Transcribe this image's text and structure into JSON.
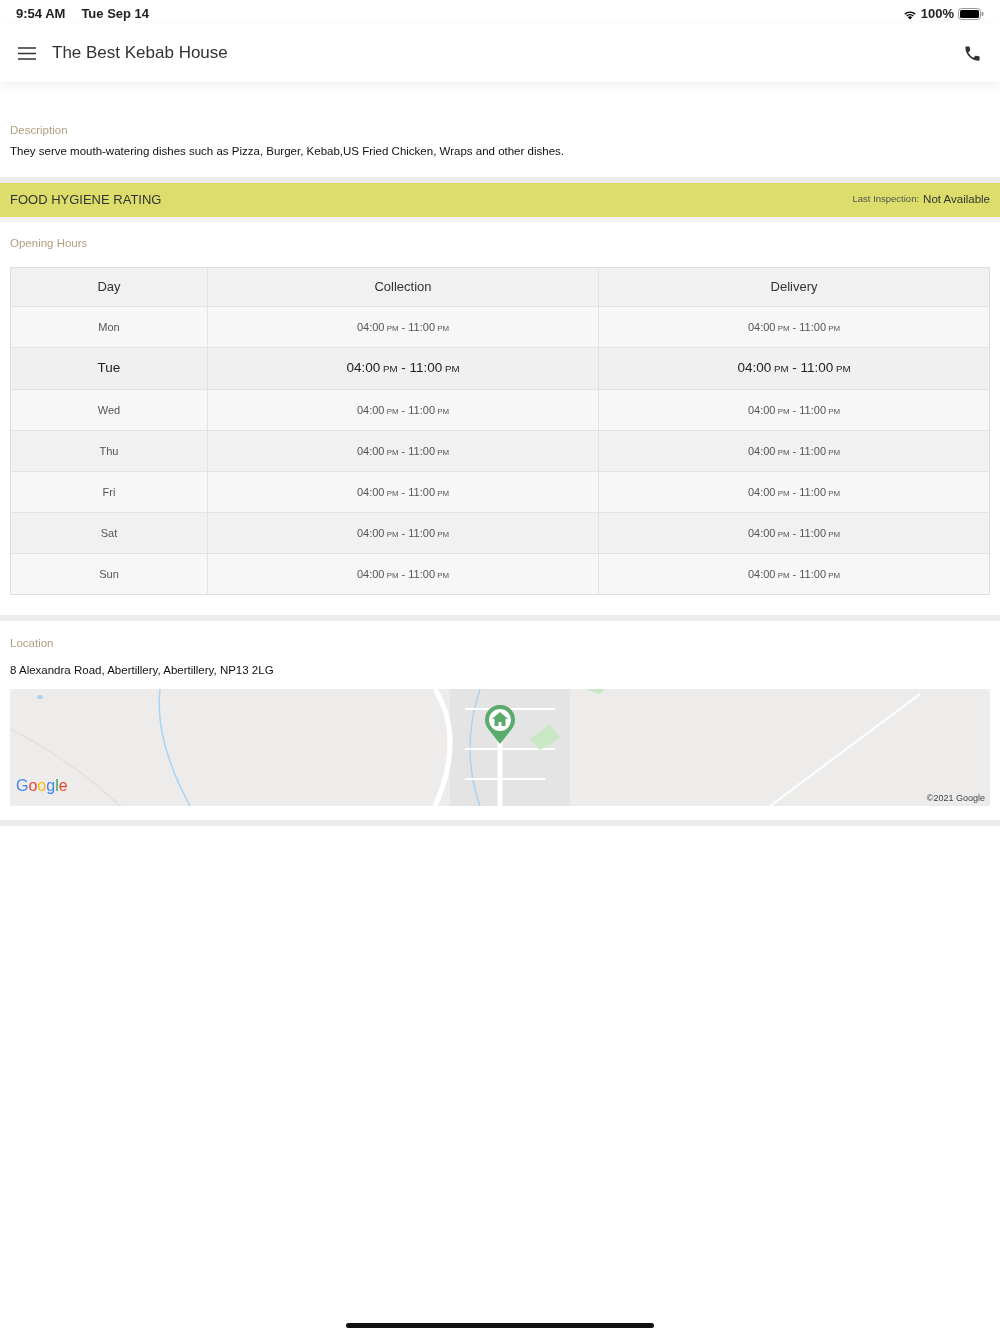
{
  "status_bar": {
    "time": "9:54 AM",
    "date": "Tue Sep 14",
    "battery": "100%"
  },
  "header": {
    "title": "The Best Kebab House"
  },
  "description": {
    "label": "Description",
    "text": "They serve mouth-watering dishes such as Pizza, Burger, Kebab,US Fried Chicken, Wraps  and other dishes."
  },
  "hygiene": {
    "title": "FOOD HYGIENE RATING",
    "inspection_label": "Last Inspection:",
    "inspection_value": "Not Available"
  },
  "opening_hours": {
    "label": "Opening Hours",
    "columns": [
      "Day",
      "Collection",
      "Delivery"
    ],
    "rows": [
      {
        "day": "Mon",
        "selected": false,
        "collection": {
          "from": "04:00",
          "from_suffix": "PM",
          "separator": "-",
          "to": "11:00",
          "to_suffix": "PM"
        },
        "delivery": {
          "from": "04:00",
          "from_suffix": "PM",
          "separator": "-",
          "to": "11:00",
          "to_suffix": "PM"
        }
      },
      {
        "day": "Tue",
        "selected": true,
        "collection": {
          "from": "04:00",
          "from_suffix": "PM",
          "separator": "-",
          "to": "11:00",
          "to_suffix": "PM"
        },
        "delivery": {
          "from": "04:00",
          "from_suffix": "PM",
          "separator": "-",
          "to": "11:00",
          "to_suffix": "PM"
        }
      },
      {
        "day": "Wed",
        "selected": false,
        "collection": {
          "from": "04:00",
          "from_suffix": "PM",
          "separator": "-",
          "to": "11:00",
          "to_suffix": "PM"
        },
        "delivery": {
          "from": "04:00",
          "from_suffix": "PM",
          "separator": "-",
          "to": "11:00",
          "to_suffix": "PM"
        }
      },
      {
        "day": "Thu",
        "selected": false,
        "collection": {
          "from": "04:00",
          "from_suffix": "PM",
          "separator": "-",
          "to": "11:00",
          "to_suffix": "PM"
        },
        "delivery": {
          "from": "04:00",
          "from_suffix": "PM",
          "separator": "-",
          "to": "11:00",
          "to_suffix": "PM"
        }
      },
      {
        "day": "Fri",
        "selected": false,
        "collection": {
          "from": "04:00",
          "from_suffix": "PM",
          "separator": "-",
          "to": "11:00",
          "to_suffix": "PM"
        },
        "delivery": {
          "from": "04:00",
          "from_suffix": "PM",
          "separator": "-",
          "to": "11:00",
          "to_suffix": "PM"
        }
      },
      {
        "day": "Sat",
        "selected": false,
        "collection": {
          "from": "04:00",
          "from_suffix": "PM",
          "separator": "-",
          "to": "11:00",
          "to_suffix": "PM"
        },
        "delivery": {
          "from": "04:00",
          "from_suffix": "PM",
          "separator": "-",
          "to": "11:00",
          "to_suffix": "PM"
        }
      },
      {
        "day": "Sun",
        "selected": false,
        "collection": {
          "from": "04:00",
          "from_suffix": "PM",
          "separator": "-",
          "to": "11:00",
          "to_suffix": "PM"
        },
        "delivery": {
          "from": "04:00",
          "from_suffix": "PM",
          "separator": "-",
          "to": "11:00",
          "to_suffix": "PM"
        }
      }
    ]
  },
  "location": {
    "label": "Location",
    "address": "8 Alexandra Road, Abertillery, Abertillery, NP13 2LG",
    "map": {
      "kind": "picture",
      "logo": "Google",
      "attribution": "©2021 Google"
    }
  }
}
